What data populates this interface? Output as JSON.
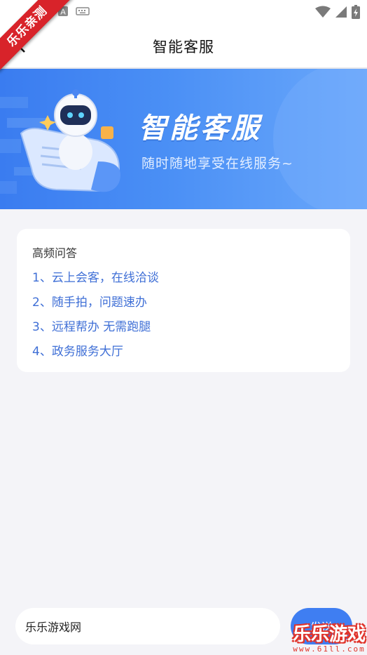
{
  "ribbon_text": "乐乐亲测",
  "header": {
    "title": "智能客服"
  },
  "banner": {
    "title": "智能客服",
    "subtitle": "随时随地享受在线服务~"
  },
  "faq": {
    "heading": "高频问答",
    "items": [
      {
        "label": "1、云上会客，在线洽谈"
      },
      {
        "label": "2、随手拍，问题速办"
      },
      {
        "label": "3、远程帮办 无需跑腿"
      },
      {
        "label": "4、政务服务大厅"
      }
    ]
  },
  "input": {
    "value": "乐乐游戏网"
  },
  "send": {
    "label": "发送"
  },
  "watermark": {
    "title": "乐乐游戏",
    "url": "www.61ll.com"
  },
  "colors": {
    "accent": "#3f7ef2",
    "link": "#3f6fd6",
    "page_bg": "#f4f4f8",
    "ribbon": "#d8232a"
  }
}
